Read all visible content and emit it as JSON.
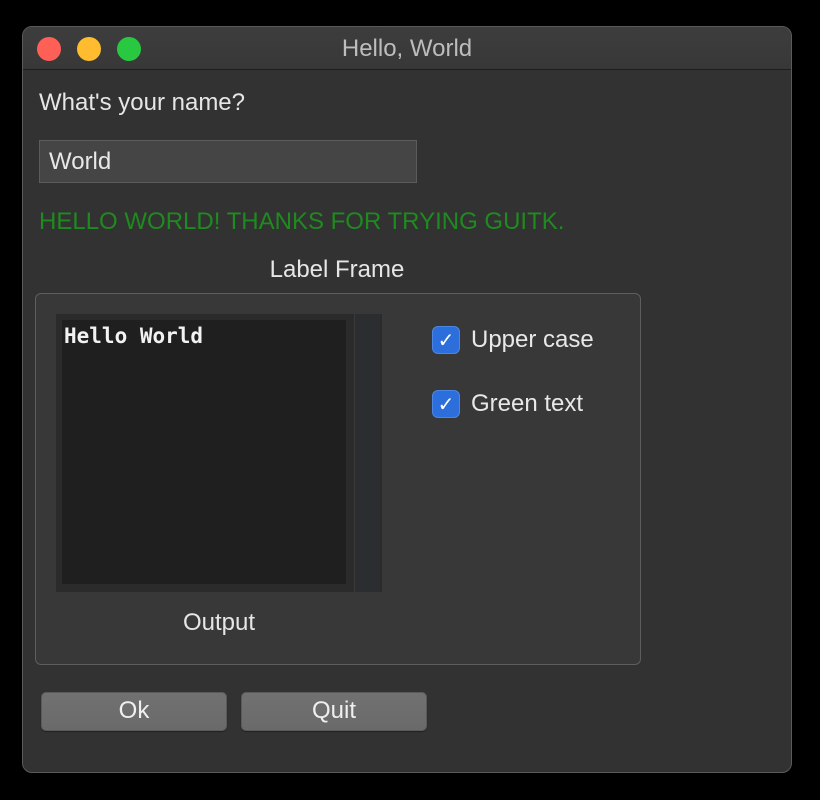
{
  "window": {
    "title": "Hello, World"
  },
  "form": {
    "prompt": "What's your name?",
    "name_value": "World",
    "greeting": "HELLO WORLD! THANKS FOR TRYING GUITK."
  },
  "frame": {
    "label": "Label Frame",
    "output_text": "Hello World",
    "output_label": "Output",
    "checkboxes": [
      {
        "label": "Upper case",
        "checked": true
      },
      {
        "label": "Green text",
        "checked": true
      }
    ]
  },
  "buttons": {
    "ok": "Ok",
    "quit": "Quit"
  },
  "colors": {
    "greeting": "#1f8a1f",
    "checkbox_accent": "#2c6fdc",
    "close": "#fe5f57",
    "minimize": "#febc2e",
    "zoom": "#28c840"
  },
  "icons": {
    "check": "✓"
  }
}
